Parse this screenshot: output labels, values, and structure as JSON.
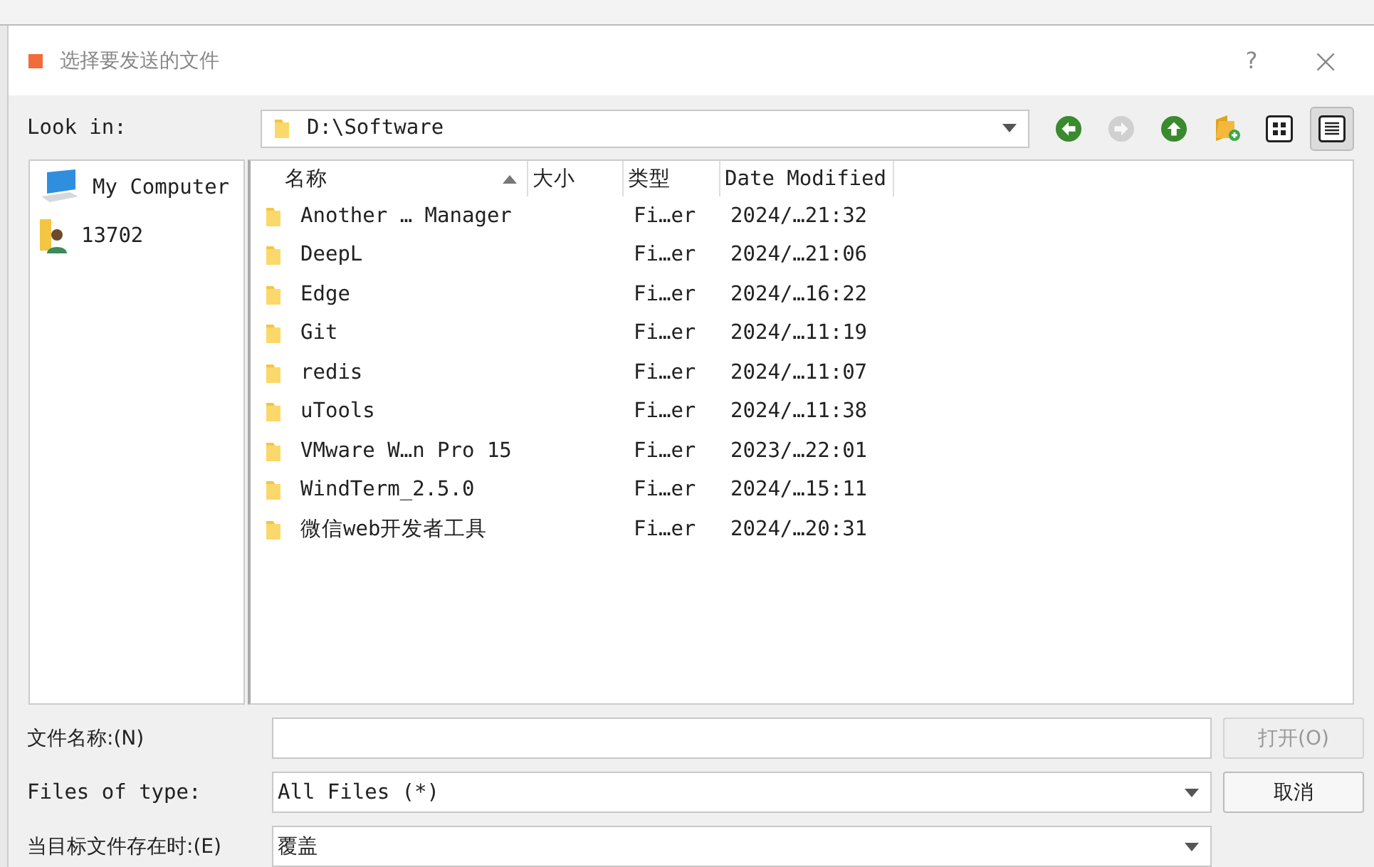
{
  "window": {
    "title": "选择要发送的文件",
    "help": "?",
    "close": "×"
  },
  "look_in": {
    "label": "Look in:",
    "value": "D:\\Software"
  },
  "toolbar": [
    {
      "kind": "back",
      "disabled": false,
      "selected": false
    },
    {
      "kind": "forward",
      "disabled": true,
      "selected": false
    },
    {
      "kind": "up",
      "disabled": false,
      "selected": false
    },
    {
      "kind": "new-folder",
      "disabled": false,
      "selected": false
    },
    {
      "kind": "icon-view",
      "disabled": false,
      "selected": false
    },
    {
      "kind": "detail-view",
      "disabled": false,
      "selected": true
    }
  ],
  "sidebar": {
    "items": [
      {
        "kind": "computer",
        "label": "My Computer"
      },
      {
        "kind": "user",
        "label": "13702"
      }
    ]
  },
  "table": {
    "columns": [
      {
        "label": "名称",
        "sorted": true
      },
      {
        "label": "大小",
        "sorted": false
      },
      {
        "label": "类型",
        "sorted": false
      },
      {
        "label": "Date Modified",
        "sorted": false
      }
    ],
    "rows": [
      {
        "name": "Another … Manager",
        "type": "Fi…er",
        "date": "2024/…21:32"
      },
      {
        "name": "DeepL",
        "type": "Fi…er",
        "date": "2024/…21:06"
      },
      {
        "name": "Edge",
        "type": "Fi…er",
        "date": "2024/…16:22"
      },
      {
        "name": "Git",
        "type": "Fi…er",
        "date": "2024/…11:19"
      },
      {
        "name": "redis",
        "type": "Fi…er",
        "date": "2024/…11:07"
      },
      {
        "name": "uTools",
        "type": "Fi…er",
        "date": "2024/…11:38"
      },
      {
        "name": "VMware W…n Pro 15",
        "type": "Fi…er",
        "date": "2023/…22:01"
      },
      {
        "name": "WindTerm_2.5.0",
        "type": "Fi…er",
        "date": "2024/…15:11"
      },
      {
        "name": "微信web开发者工具",
        "type": "Fi…er",
        "date": "2024/…20:31"
      }
    ]
  },
  "file_name": {
    "label": "文件名称:(N)"
  },
  "file_type": {
    "label": "Files of type:",
    "value": "All Files (*)"
  },
  "exists_action": {
    "label": "当目标文件存在时:(E)",
    "value": "覆盖"
  },
  "buttons": [
    {
      "label": "打开(O)",
      "disabled": true
    },
    {
      "label": "取消",
      "disabled": false
    }
  ]
}
